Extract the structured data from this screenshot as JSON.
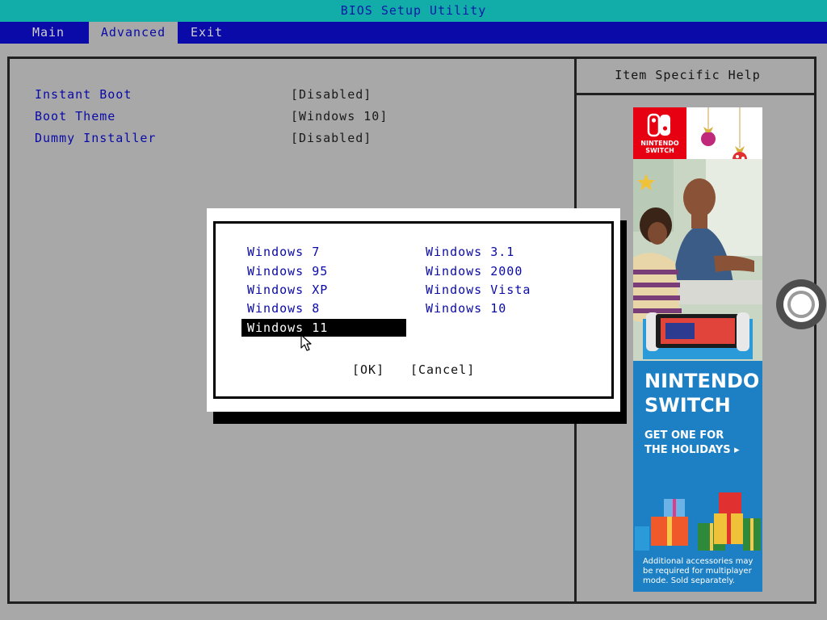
{
  "window": {
    "title": "BIOS Setup Utility"
  },
  "menu": {
    "items": [
      {
        "label": "Main"
      },
      {
        "label": "Advanced",
        "active": true
      },
      {
        "label": "Exit"
      }
    ]
  },
  "settings": [
    {
      "label": "Instant Boot",
      "value": "[Disabled]"
    },
    {
      "label": "Boot Theme",
      "value": "[Windows 10]"
    },
    {
      "label": "Dummy Installer",
      "value": "[Disabled]"
    }
  ],
  "help": {
    "title": "Item Specific Help"
  },
  "dialog": {
    "options": [
      {
        "label": "Windows 7"
      },
      {
        "label": "Windows 95"
      },
      {
        "label": "Windows XP"
      },
      {
        "label": "Windows 8"
      },
      {
        "label": "Windows 11",
        "selected": true
      },
      {
        "label": "Windows 3.1"
      },
      {
        "label": "Windows 2000"
      },
      {
        "label": "Windows Vista"
      },
      {
        "label": "Windows 10"
      }
    ],
    "ok_label": "[OK]",
    "cancel_label": "[Cancel]"
  },
  "ad": {
    "logo_text": "NINTENDO SWITCH",
    "headline_line1": "NINTENDO",
    "headline_line2": "SWITCH",
    "sub_line1": "GET ONE FOR",
    "sub_line2": "THE HOLIDAYS ▸",
    "disclaimer": "Additional accessories may be required for multiplayer mode. Sold separately.",
    "colors": {
      "background": "#1e80c4",
      "logo": "#e60012"
    }
  },
  "colors": {
    "titlebar_bg": "#12aca9",
    "menubar_bg": "#0a0aa8",
    "panel_bg": "#a8a8a8",
    "label_blue": "#0a0aa8"
  }
}
